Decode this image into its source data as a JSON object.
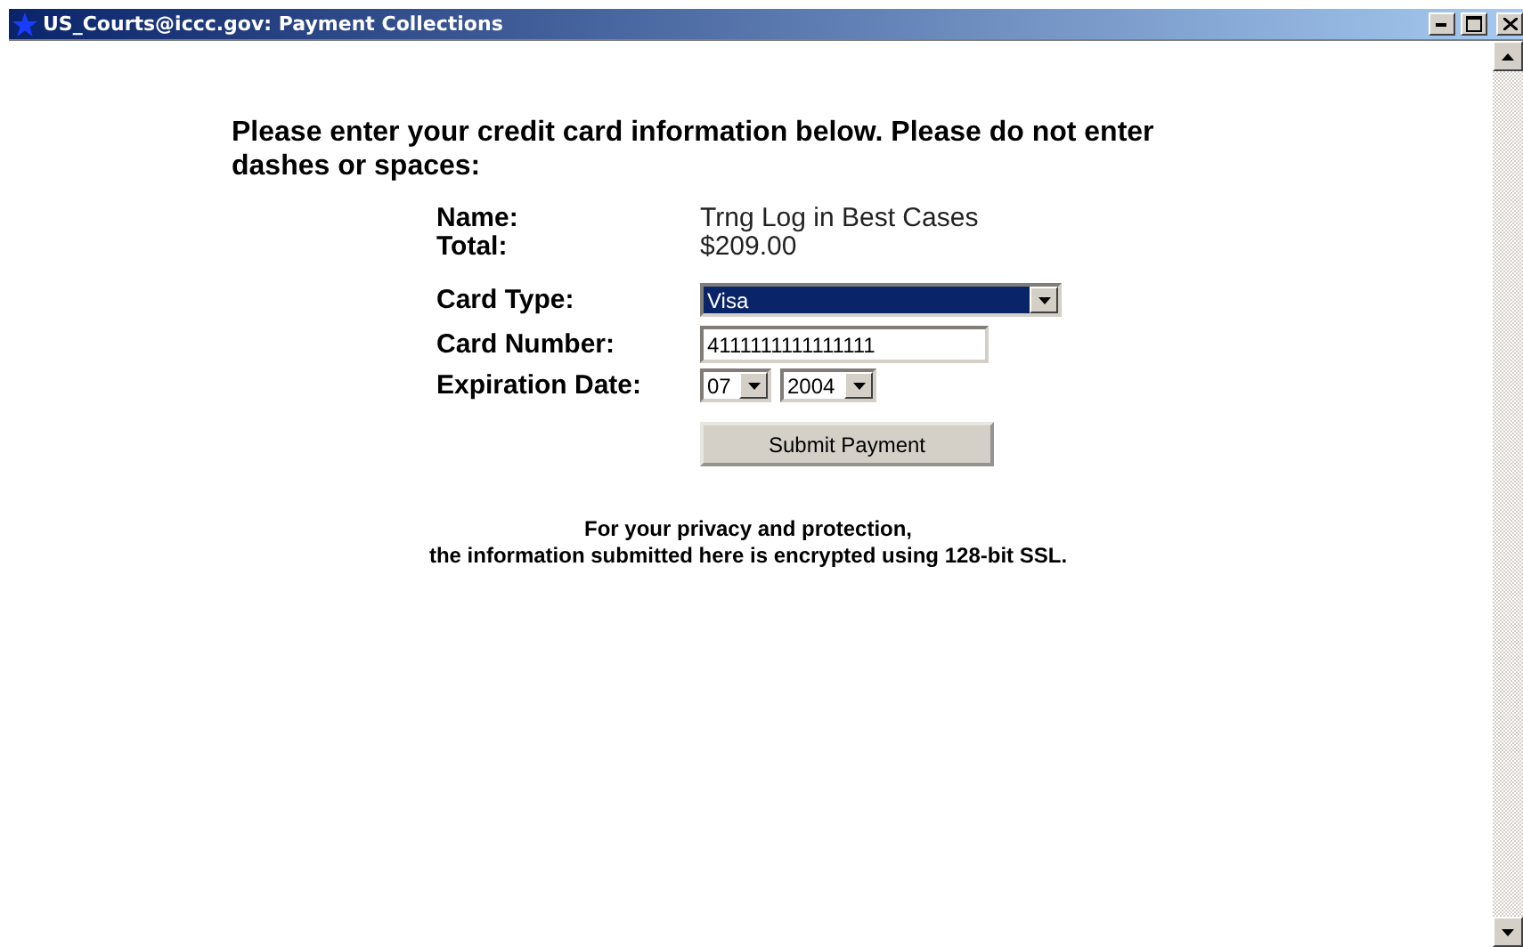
{
  "window": {
    "title": "US_Courts@iccc.gov: Payment Collections"
  },
  "instructions": "Please enter your credit card information below. Please do not enter dashes or spaces:",
  "summary": [
    {
      "label": "Name:",
      "value": "Trng Log in Best Cases"
    },
    {
      "label": "Total:",
      "value": "$209.00"
    }
  ],
  "form": {
    "card_type": {
      "label": "Card Type:",
      "value": "Visa"
    },
    "card_number": {
      "label": "Card Number:",
      "value": "4111111111111111"
    },
    "expiration": {
      "label": "Expiration Date:",
      "month": "07",
      "year": "2004"
    },
    "submit": "Submit Payment"
  },
  "footer": [
    "For your privacy and protection,",
    "the information submitted here is encrypted using 128-bit SSL."
  ]
}
